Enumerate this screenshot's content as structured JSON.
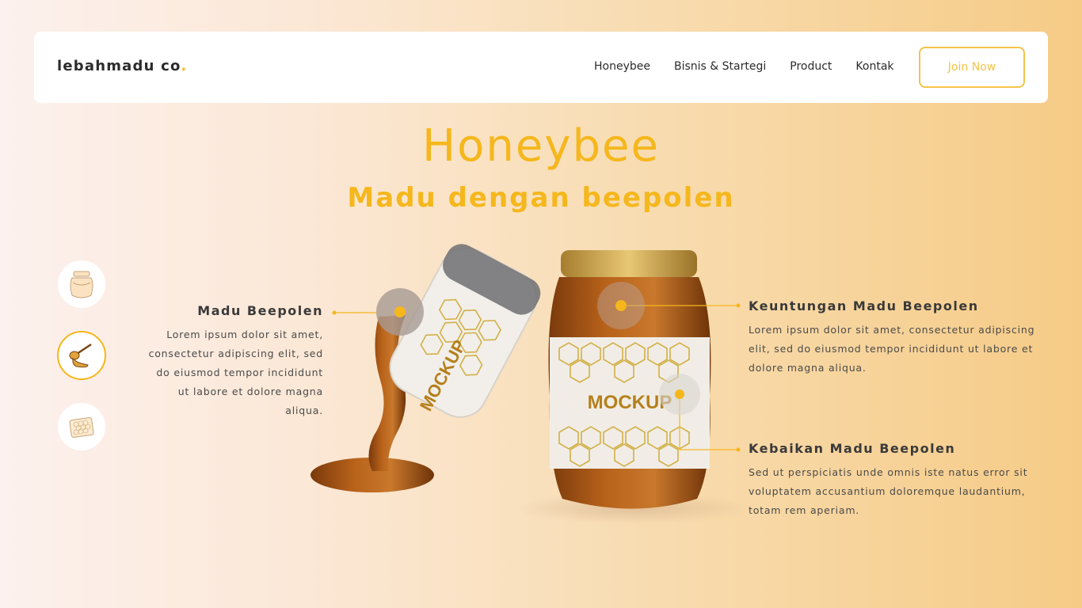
{
  "brand": {
    "name": "lebahmadu co",
    "dot": "."
  },
  "nav": {
    "links": [
      "Honeybee",
      "Bisnis & Startegi",
      "Product",
      "Kontak"
    ],
    "cta": "Join Now"
  },
  "hero": {
    "title": "Honeybee",
    "subtitle": "Madu dengan beepolen"
  },
  "side_icons": [
    "honey-jar-icon",
    "honey-dipper-icon",
    "honeycomb-icon"
  ],
  "product": {
    "label_text": "MOCKUP"
  },
  "features": {
    "left": {
      "title": "Madu Beepolen",
      "text": "Lorem ipsum dolor sit amet, consectetur adipiscing elit, sed do eiusmod tempor incididunt ut labore et dolore magna aliqua."
    },
    "right_top": {
      "title": "Keuntungan Madu Beepolen",
      "text": "Lorem ipsum dolor sit amet, consectetur adipiscing elit, sed do eiusmod tempor incididunt ut labore et dolore magna aliqua."
    },
    "right_bottom": {
      "title": "Kebaikan Madu Beepolen",
      "text": "Sed ut perspiciatis unde omnis iste natus error sit voluptatem accusantium doloremque laudantium, totam rem aperiam."
    }
  },
  "colors": {
    "accent": "#f5b71c",
    "honey": "#b8621a",
    "lid": "#c9a04a"
  }
}
